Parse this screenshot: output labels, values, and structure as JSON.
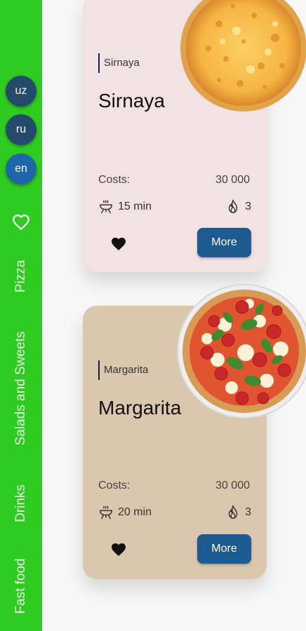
{
  "languages": [
    "uz",
    "ru",
    "en"
  ],
  "active_language": "en",
  "categories": [
    "Pizza",
    "Salads and Sweets",
    "Drinks",
    "Fast food"
  ],
  "icons": {
    "favorites": "heart-outline-icon",
    "cook_time": "grill-icon",
    "spiciness": "flame-icon",
    "favorite": "heart-icon"
  },
  "colors": {
    "sidebar": "#2ecc20",
    "more_button": "#1d5a91",
    "lang_active": "#1f66a8"
  },
  "cards": [
    {
      "tag": "Sirnaya",
      "title": "Sirnaya",
      "cost_label": "Costs:",
      "cost": "30 000",
      "time": "15 min",
      "spicy": "3",
      "more": "More",
      "image": "cheese-pizza"
    },
    {
      "tag": "Margarita",
      "title": "Margarita",
      "cost_label": "Costs:",
      "cost": "30 000",
      "time": "20 min",
      "spicy": "3",
      "more": "More",
      "image": "margherita-pizza"
    }
  ]
}
